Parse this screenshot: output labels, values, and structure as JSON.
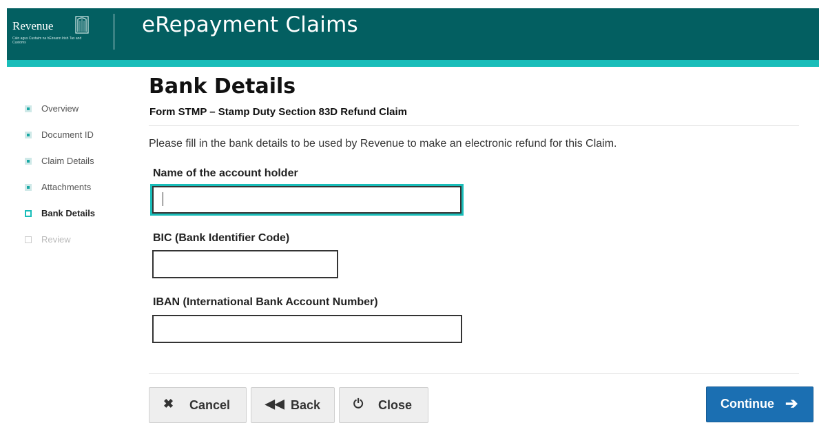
{
  "header": {
    "logo_text": "Revenue",
    "logo_subtext": "Cáin agus Custaim na hÉireann Irish Tax and Customs",
    "app_title": "eRepayment Claims"
  },
  "sidebar": {
    "items": [
      {
        "label": "Overview",
        "state": "done"
      },
      {
        "label": "Document ID",
        "state": "done"
      },
      {
        "label": "Claim Details",
        "state": "done"
      },
      {
        "label": "Attachments",
        "state": "done"
      },
      {
        "label": "Bank Details",
        "state": "current"
      },
      {
        "label": "Review",
        "state": "future"
      }
    ]
  },
  "main": {
    "title": "Bank Details",
    "subtitle": "Form STMP – Stamp Duty Section 83D Refund Claim",
    "intro": "Please fill in the bank details to be used by Revenue to make an electronic refund for this Claim.",
    "fields": {
      "account_holder": {
        "label": "Name of the account holder",
        "value": ""
      },
      "bic": {
        "label": "BIC (Bank Identifier Code)",
        "value": ""
      },
      "iban": {
        "label": "IBAN (International Bank Account Number)",
        "value": ""
      }
    }
  },
  "actions": {
    "cancel_label": "Cancel",
    "back_label": "Back",
    "close_label": "Close",
    "continue_label": "Continue"
  },
  "colors": {
    "header": "#035f61",
    "accent": "#19bdb9",
    "primary": "#1b6fb2"
  }
}
